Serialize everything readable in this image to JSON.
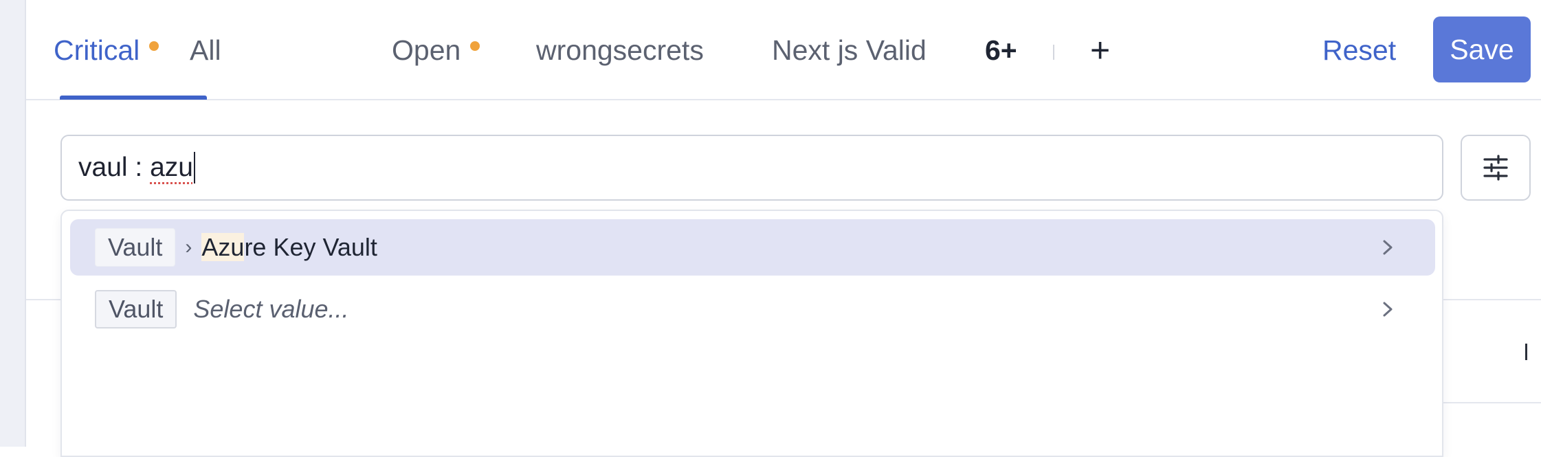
{
  "colors": {
    "accent": "#3f63c9",
    "save_button": "#5a78d8",
    "warning_dot": "#f0a23b",
    "highlight_row": "#e1e3f4"
  },
  "tabs": [
    {
      "label": "Critical",
      "active": true,
      "indicator": "dot"
    },
    {
      "label": "All"
    },
    {
      "label": "Open",
      "indicator": "dot"
    },
    {
      "label": "wrongsecrets"
    },
    {
      "label": "Next js Valid"
    }
  ],
  "overflow_tabs_label": "6+",
  "add_tab_label": "+",
  "actions": {
    "reset_label": "Reset",
    "save_label": "Save"
  },
  "search": {
    "value_prefix": "vaul : ",
    "value_misspelled": "azu",
    "filter_icon": "sliders-icon"
  },
  "dropdown": {
    "options": [
      {
        "chip": "Vault",
        "separator": "›",
        "label_match": "Azu",
        "label_rest": "re Key Vault",
        "highlighted": true,
        "icon": "chevron-right-icon"
      },
      {
        "chip": "Vault",
        "placeholder": "Select value...",
        "highlighted": false,
        "icon": "chevron-right-icon"
      }
    ]
  }
}
